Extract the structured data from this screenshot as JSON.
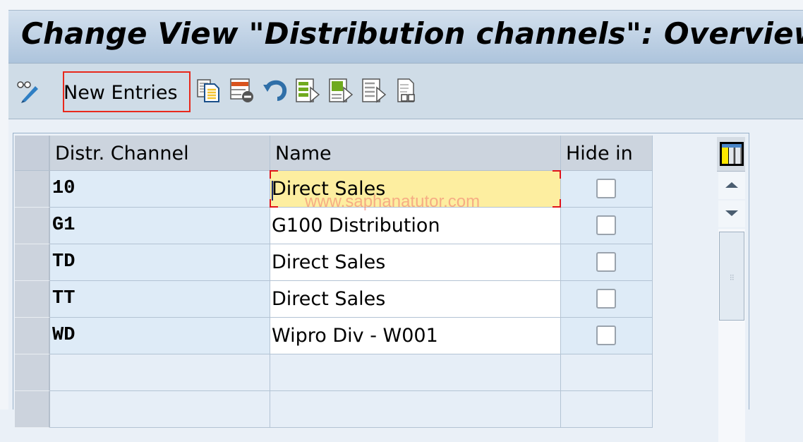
{
  "window": {
    "title": "Change View \"Distribution channels\": Overview"
  },
  "toolbar": {
    "display_change_icon": "glasses-pencil-icon",
    "new_entries_label": "New Entries",
    "icons": [
      "copy-as-icon",
      "delete-icon",
      "undo-change-icon",
      "select-all-icon",
      "select-block-icon",
      "deselect-all-icon",
      "print-view-icon"
    ]
  },
  "table": {
    "columns": [
      "Distr. Channel",
      "Name",
      "Hide in"
    ],
    "rows": [
      {
        "channel": "10",
        "name": "Direct Sales",
        "hide": false,
        "focused": true
      },
      {
        "channel": "G1",
        "name": "G100 Distribution",
        "hide": false
      },
      {
        "channel": "TD",
        "name": "Direct Sales",
        "hide": false
      },
      {
        "channel": "TT",
        "name": "Direct Sales",
        "hide": false
      },
      {
        "channel": "WD",
        "name": "Wipro Div - W001",
        "hide": false
      }
    ],
    "empty_rows": 2
  },
  "watermark": "www.saphanatutor.com",
  "colors": {
    "title_bar": "#adc4dc",
    "toolbar_bg": "#cfdce7",
    "highlight_border": "#e8281c",
    "focused_cell": "#fdeea0",
    "key_cell": "#deebf7"
  }
}
